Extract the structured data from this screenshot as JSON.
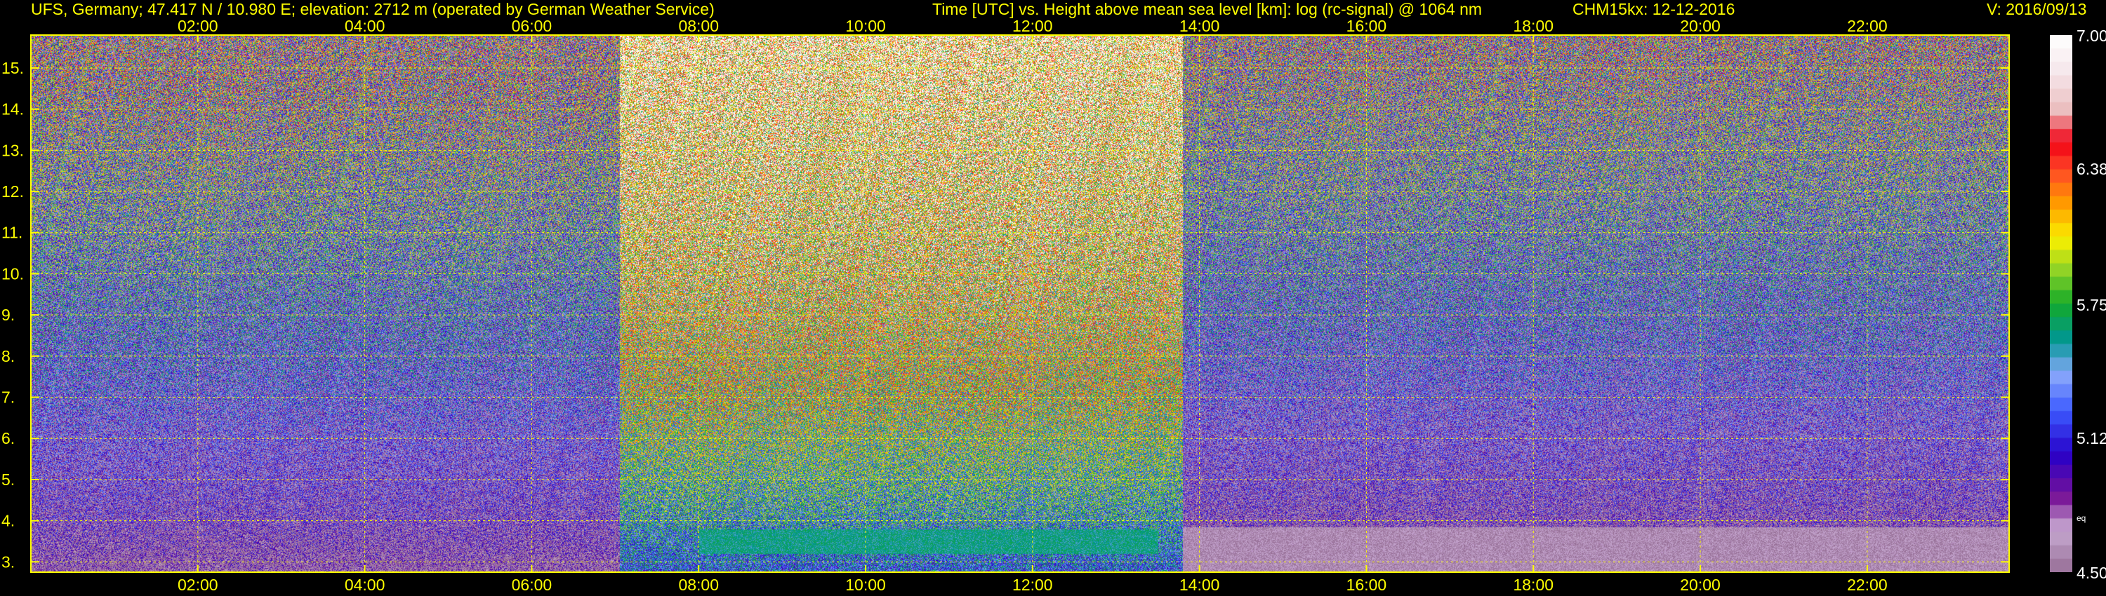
{
  "header": {
    "station": "UFS, Germany; 47.417 N / 10.980 E; elevation: 2712 m  (operated by German Weather Service)",
    "plot_title": "Time [UTC] vs. Height above mean sea level [km]: log (rc-signal) @ 1064 nm",
    "instrument_date": "CHM15kx: 12-12-2016",
    "version": "V: 2016/09/13"
  },
  "colorbar": {
    "labels": [
      "7.00",
      "6.38",
      "5.75",
      "5.12",
      "4.50"
    ],
    "small_label": "eq",
    "min": 4.5,
    "max": 7.0
  },
  "chart_data": {
    "type": "heatmap",
    "title": "Time [UTC] vs. Height above mean sea level [km]: log (rc-signal) @ 1064 nm",
    "xlabel": "Time [UTC]",
    "ylabel": "Height above mean sea level [km]",
    "x_range_hours": [
      0,
      23.7
    ],
    "x_ticks": [
      "02:00",
      "04:00",
      "06:00",
      "08:00",
      "10:00",
      "12:00",
      "14:00",
      "16:00",
      "18:00",
      "20:00",
      "22:00"
    ],
    "x_tick_hours": [
      2,
      4,
      6,
      8,
      10,
      12,
      14,
      16,
      18,
      20,
      22
    ],
    "y_range_km": [
      2.75,
      15.8
    ],
    "y_ticks": [
      "3.",
      "4.",
      "5.",
      "6.",
      "7.",
      "8.",
      "9.",
      "10.",
      "11.",
      "12.",
      "13.",
      "14.",
      "15."
    ],
    "y_tick_values": [
      3,
      4,
      5,
      6,
      7,
      8,
      9,
      10,
      11,
      12,
      13,
      14,
      15
    ],
    "grid": true,
    "colorscale_range": [
      4.5,
      7.0
    ],
    "colors": {
      "axis": "#ffff00",
      "grid": "#ffff00",
      "text": "#ffff00",
      "colorbar_labels": "#ffffff"
    },
    "regions": [
      {
        "x_start": 0,
        "x_end": 7.05,
        "description": "night background",
        "top_value": 5.6,
        "bottom_value": 4.6
      },
      {
        "x_start": 7.05,
        "x_end": 13.8,
        "description": "daytime background",
        "top_value": 6.7,
        "bottom_value": 5.3
      },
      {
        "x_start": 13.8,
        "x_end": 23.7,
        "description": "night background",
        "top_value": 5.5,
        "bottom_value": 4.55
      }
    ],
    "features": [
      {
        "name": "boundary layer signal",
        "x_start": 8.0,
        "x_end": 13.5,
        "height_km": [
          3.2,
          3.8
        ],
        "value": 5.6
      },
      {
        "name": "near-surface low signal",
        "x_start": 13.8,
        "x_end": 23.7,
        "height_km": [
          2.75,
          3.85
        ],
        "value": 4.6
      }
    ]
  }
}
